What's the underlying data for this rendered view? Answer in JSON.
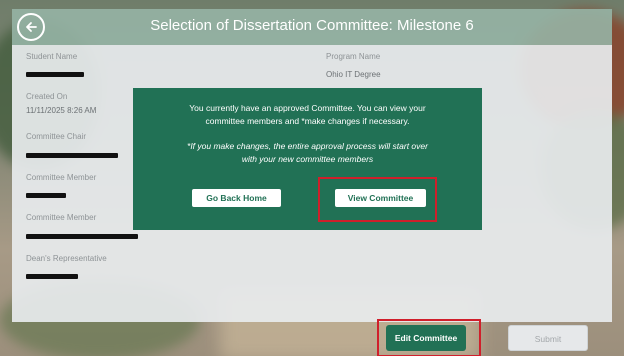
{
  "header": {
    "title": "Selection of Dissertation Committee: Milestone 6",
    "back_icon": "back-arrow-icon"
  },
  "form": {
    "student_name_label": "Student Name",
    "program_name_label": "Program Name",
    "program_name_value": "Ohio IT Degree",
    "created_on_label": "Created On",
    "created_on_value": "11/11/2025 8:26 AM",
    "committee_chair_label": "Committee Chair",
    "committee_member_label_1": "Committee Member",
    "committee_member_label_2": "Committee Member",
    "deans_rep_label": "Dean's Representative"
  },
  "modal": {
    "message_line1": "You currently have an approved Committee. You can view your",
    "message_line2": "committee members and *make changes if necessary.",
    "warning_line1": "*If you make changes, the entire approval process will start over",
    "warning_line2": "with your new committee members",
    "go_back_label": "Go Back Home",
    "view_committee_label": "View Committee"
  },
  "footer": {
    "edit_label": "Edit Committee",
    "submit_label": "Submit"
  },
  "colors": {
    "accent_green": "#217155",
    "header_green": "#96b4a5",
    "highlight_red": "#d01f2b"
  }
}
